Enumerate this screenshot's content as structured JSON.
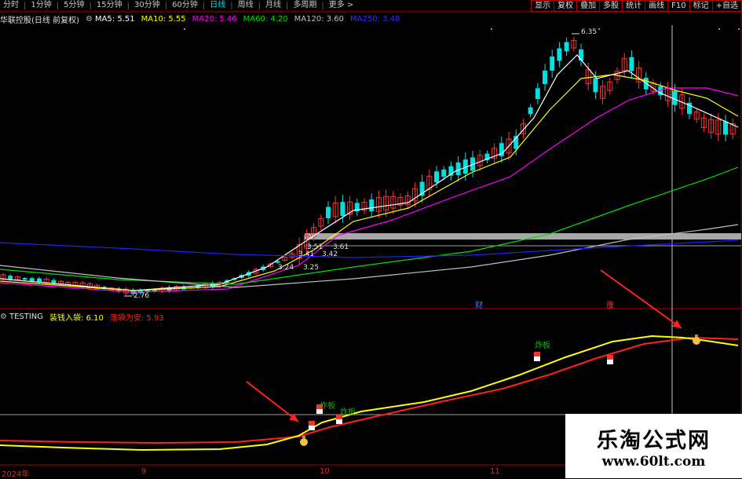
{
  "period_tabs": [
    "分时",
    "1分钟",
    "5分钟",
    "15分钟",
    "30分钟",
    "60分钟",
    "日线",
    "周线",
    "月线",
    "多周期",
    "更多 >"
  ],
  "active_tab": "日线",
  "tool_buttons": [
    "显示",
    "复权",
    "叠加",
    "多股",
    "统计",
    "画线",
    "F10",
    "标记",
    "+自选"
  ],
  "stock": {
    "name": "华联控股",
    "mode": "(日线 前复权)"
  },
  "ma_legend": [
    {
      "label": "MA5: 5.51",
      "color": "#ffffff"
    },
    {
      "label": "MA10: 5.55",
      "color": "#ffff00"
    },
    {
      "label": "MA20: 5.46",
      "color": "#ff00ff"
    },
    {
      "label": "MA60: 4.20",
      "color": "#00e000"
    },
    {
      "label": "MA120: 3.60",
      "color": "#c0c0c0"
    },
    {
      "label": "MA250: 3.48",
      "color": "#0000ff"
    }
  ],
  "indicator": {
    "name": "TESTING",
    "line1": {
      "label": "装钱入袋: 6.10",
      "color": "#ffff00"
    },
    "line2": {
      "label": "落袋为安: 5.93",
      "color": "#ff2020"
    }
  },
  "price_labels": {
    "high": "6.35",
    "low": "2.76",
    "a": "3.51",
    "b": "3.61",
    "c": "3.41",
    "d": "3.42",
    "e": "3.24",
    "f": "3.25"
  },
  "signal_label": "炸板",
  "marker_chars": {
    "cai": "财",
    "zhang": "涨"
  },
  "x_axis": [
    "2024年",
    "9",
    "10",
    "11"
  ],
  "watermark": {
    "line1": "乐淘公式网",
    "line2": "www.60lt.com"
  },
  "colors": {
    "up": "#ff3232",
    "down": "#00e0e0",
    "frame": "#b00000"
  }
}
